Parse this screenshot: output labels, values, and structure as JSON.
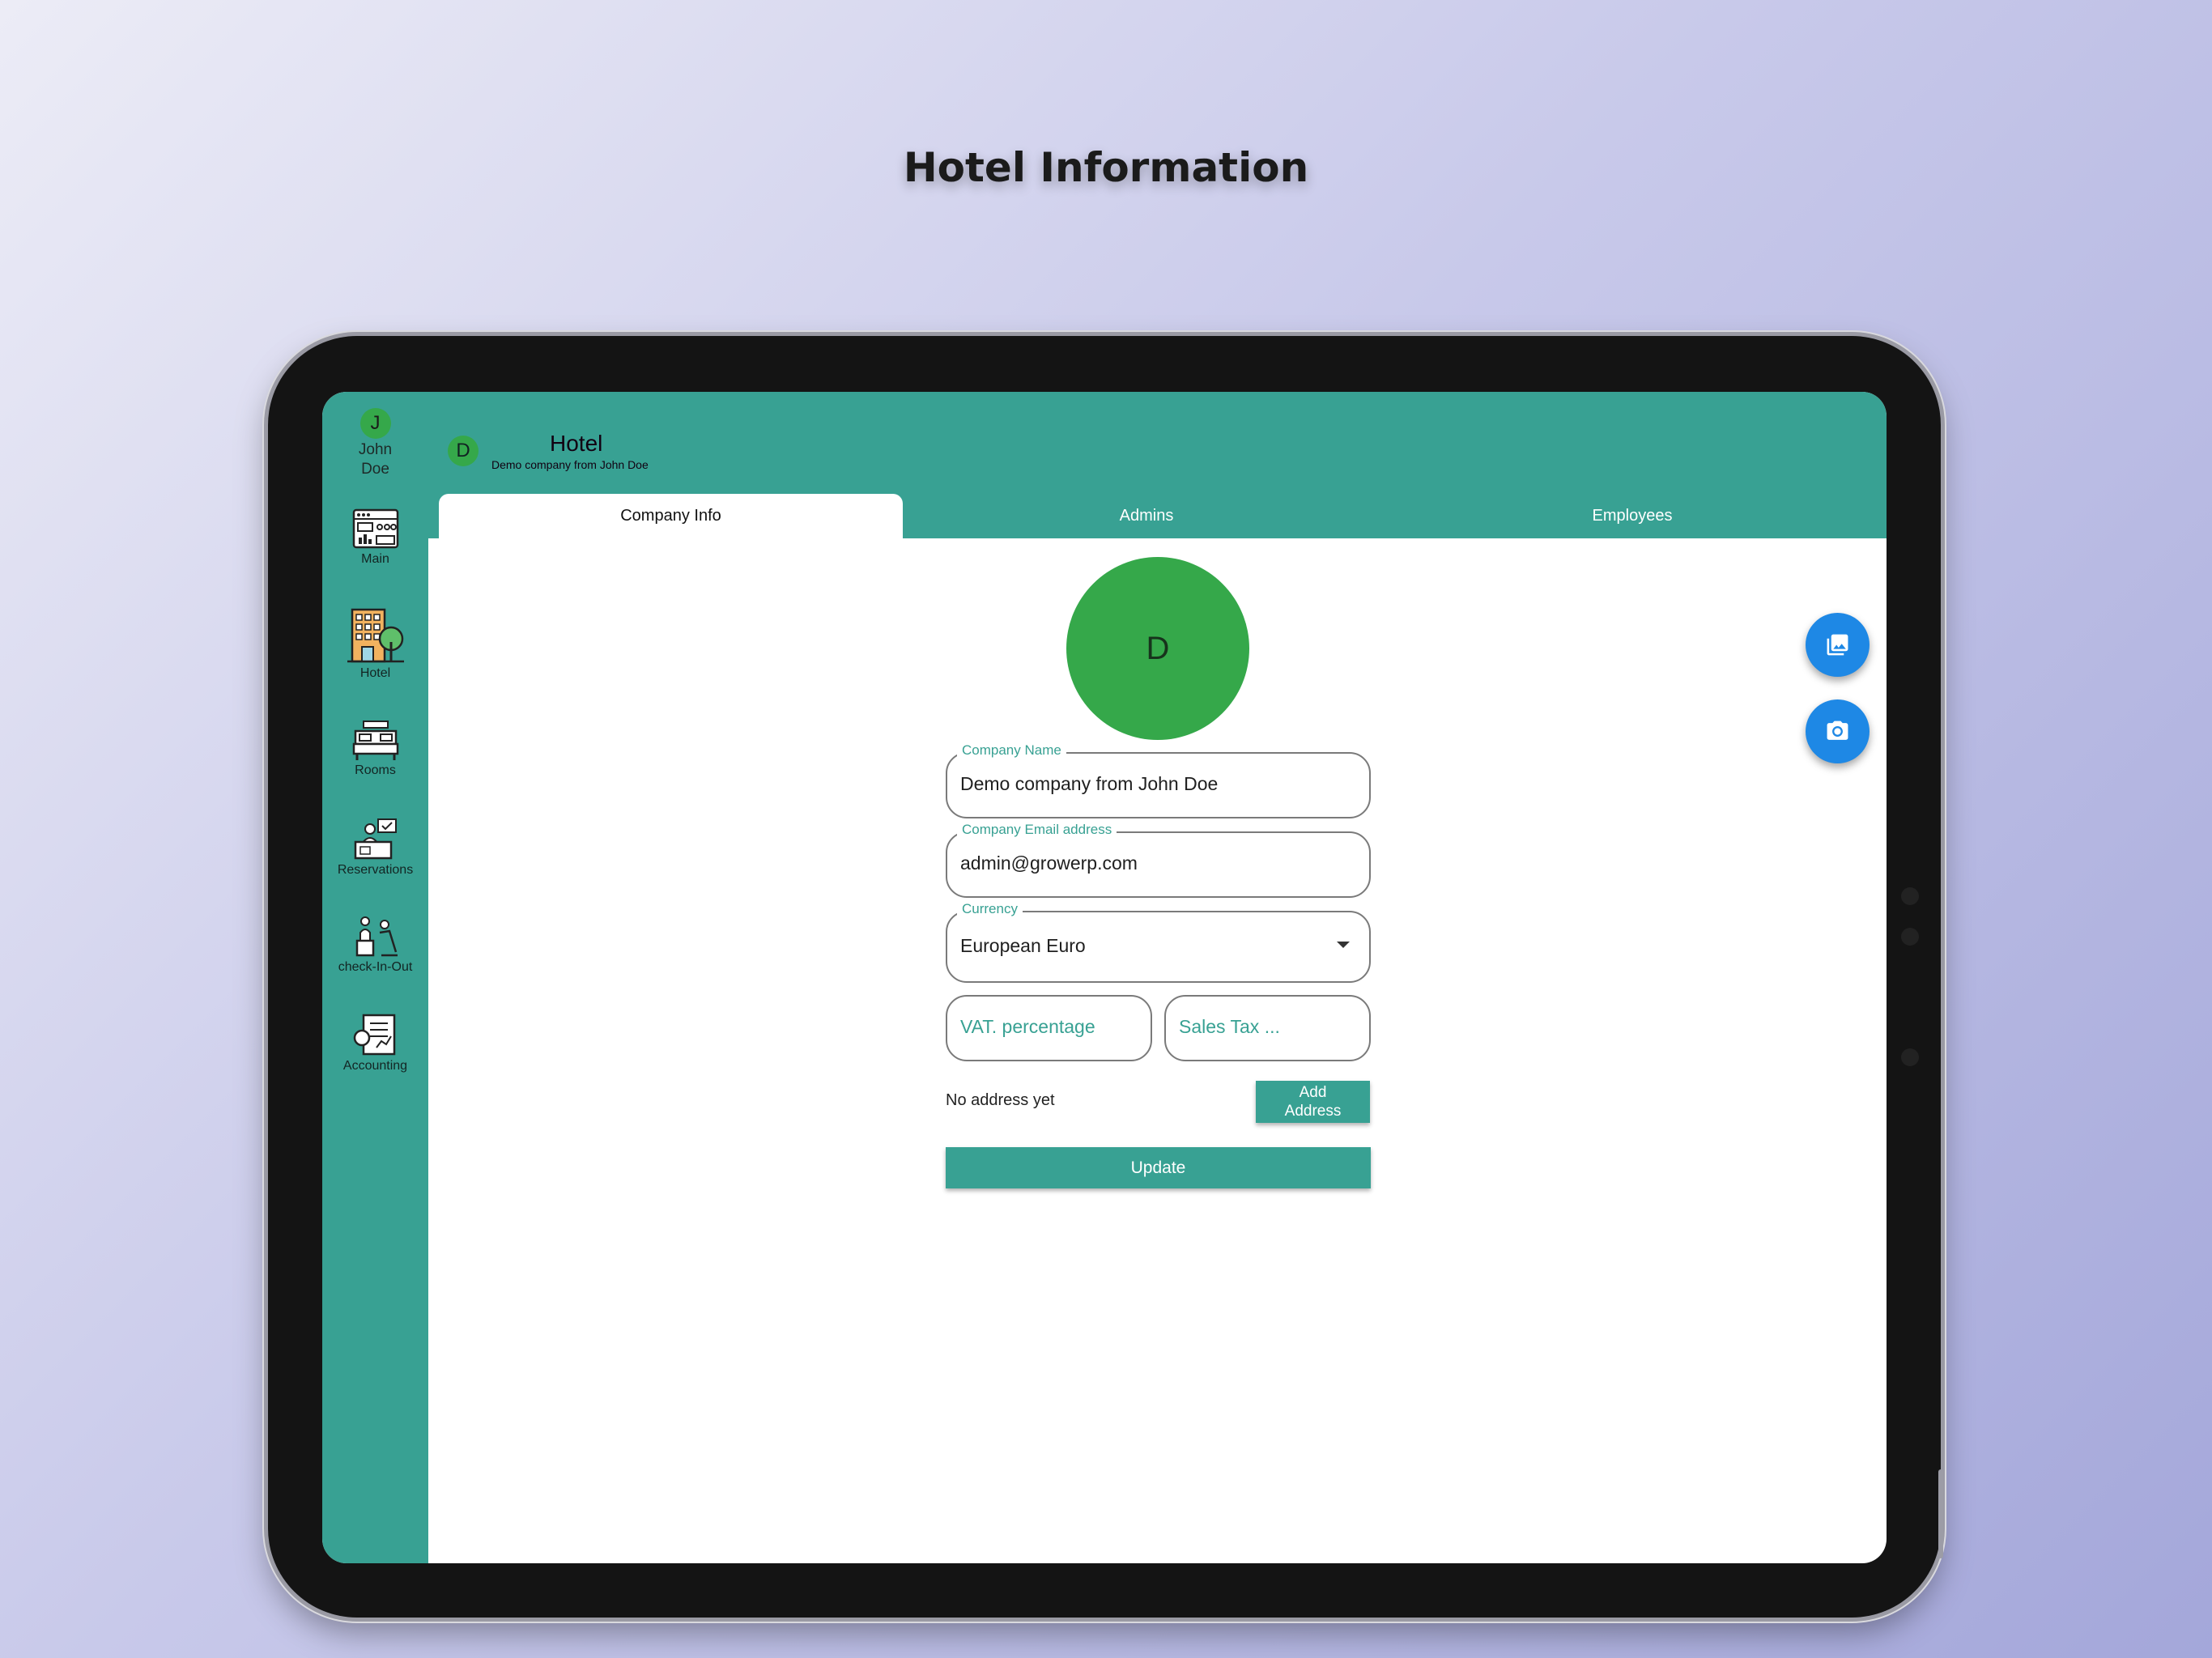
{
  "page": {
    "headline": "Hotel Information"
  },
  "rail": {
    "user_initial": "J",
    "user_name": "John Doe",
    "items": [
      {
        "label": "Main",
        "icon": "dashboard-icon"
      },
      {
        "label": "Hotel",
        "icon": "hotel-building-icon"
      },
      {
        "label": "Rooms",
        "icon": "bed-icon"
      },
      {
        "label": "Reservations",
        "icon": "reception-desk-icon"
      },
      {
        "label": "check-In-Out",
        "icon": "bellboy-luggage-icon"
      },
      {
        "label": "Accounting",
        "icon": "ledger-icon"
      }
    ]
  },
  "header": {
    "avatar_initial": "D",
    "title": "Hotel",
    "subtitle": "Demo company from John Doe"
  },
  "tabs": [
    {
      "label": "Company Info",
      "active": true
    },
    {
      "label": "Admins",
      "active": false
    },
    {
      "label": "Employees",
      "active": false
    }
  ],
  "form": {
    "avatar_initial": "D",
    "company_name": {
      "label": "Company Name",
      "value": "Demo company from John Doe"
    },
    "company_email": {
      "label": "Company Email address",
      "value": "admin@growerp.com"
    },
    "currency": {
      "label": "Currency",
      "value": "European Euro"
    },
    "vat": {
      "placeholder": "VAT. percentage"
    },
    "sales_tax": {
      "placeholder": "Sales Tax ..."
    },
    "no_address_text": "No address yet",
    "add_address_label": "Add Address",
    "update_label": "Update"
  },
  "fabs": {
    "gallery_icon": "photo-library-icon",
    "camera_icon": "camera-icon"
  },
  "colors": {
    "teal": "#38a193",
    "green": "#35a84a",
    "fab_blue": "#1e88e5"
  }
}
